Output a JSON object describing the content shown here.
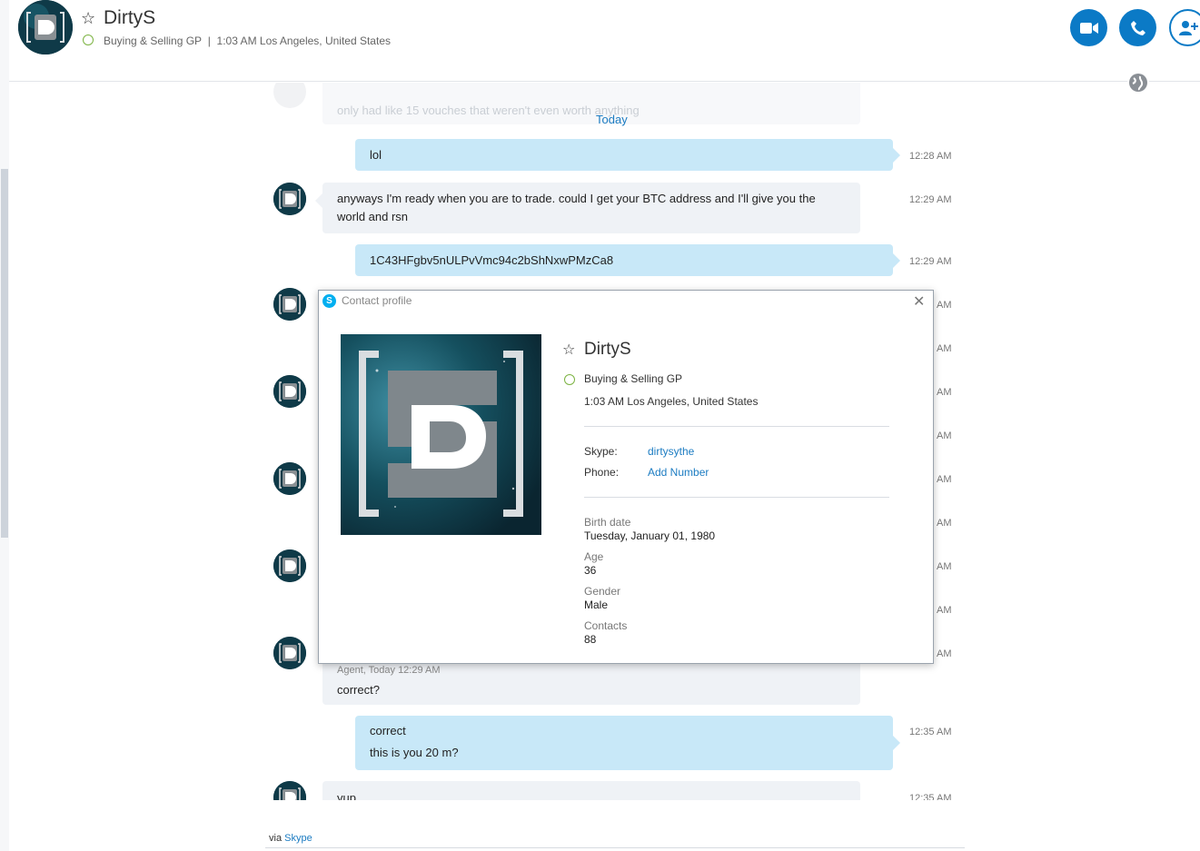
{
  "header": {
    "name": "DirtyS",
    "mood": "Buying & Selling GP",
    "separator": "|",
    "local_time": "1:03 AM Los Angeles, United States",
    "accent": "#0b7ac6"
  },
  "chat": {
    "ghost_text": "only had like 15 vouches that weren't even worth anything",
    "day_separator": "Today",
    "messages": [
      {
        "dir": "out",
        "text": "lol",
        "time": "12:28 AM"
      },
      {
        "dir": "in",
        "text": "anyways I'm ready when you are to trade. could I get your BTC address and I'll give you the world and rsn",
        "time": "12:29 AM"
      },
      {
        "dir": "out",
        "text": "1C43HFgbv5nULPvVmc94c2bShNxwPMzCa8",
        "time": "12:29 AM"
      },
      {
        "dir": "in",
        "sender": "Agent, Today 12:29 AM",
        "text": "correct?"
      },
      {
        "dir": "out",
        "lines": [
          "correct",
          "this is you 20 m?"
        ],
        "time": "12:35 AM"
      },
      {
        "dir": "in",
        "text": "yup",
        "time": "12:35 AM"
      }
    ],
    "hidden_times": [
      "AM",
      "AM",
      "AM",
      "AM",
      "AM",
      "AM",
      "AM",
      "AM",
      "AM"
    ]
  },
  "footer": {
    "via": "via",
    "link": "Skype"
  },
  "profile": {
    "title": "Contact profile",
    "name": "DirtyS",
    "mood": "Buying & Selling GP",
    "location": "1:03 AM Los Angeles, United States",
    "skype_label": "Skype:",
    "skype_value": "dirtysythe",
    "phone_label": "Phone:",
    "phone_value": "Add Number",
    "birth_label": "Birth date",
    "birth_value": "Tuesday, January 01, 1980",
    "age_label": "Age",
    "age_value": "36",
    "gender_label": "Gender",
    "gender_value": "Male",
    "contacts_label": "Contacts",
    "contacts_value": "88"
  },
  "icons": [
    "star-icon",
    "presence-icon",
    "video-call-icon",
    "audio-call-icon",
    "add-contact-icon",
    "globe-icon",
    "skype-logo-icon",
    "close-icon"
  ]
}
